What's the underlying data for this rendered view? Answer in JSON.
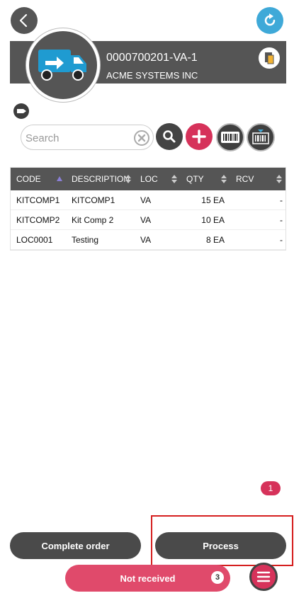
{
  "header": {
    "order_number": "0000700201-VA-1",
    "customer": "ACME SYSTEMS INC"
  },
  "search": {
    "placeholder": "Search",
    "value": ""
  },
  "grid": {
    "columns": [
      "CODE",
      "DESCRIPTION",
      "LOC",
      "QTY",
      "RCV"
    ],
    "rows": [
      {
        "code": "KITCOMP1",
        "description": "KITCOMP1",
        "loc": "VA",
        "qty": "15 EA",
        "rcv": "-"
      },
      {
        "code": "KITCOMP2",
        "description": "Kit Comp 2",
        "loc": "VA",
        "qty": "10 EA",
        "rcv": "-"
      },
      {
        "code": "LOC0001",
        "description": "Testing",
        "loc": "VA",
        "qty": "8 EA",
        "rcv": "-"
      }
    ]
  },
  "page_badge": "1",
  "actions": {
    "complete_label": "Complete order",
    "process_label": "Process",
    "not_received_label": "Not received",
    "not_received_count": "3"
  },
  "colors": {
    "accent_pink": "#d6325a",
    "refresh_blue": "#3fa9d8",
    "header_gray": "#555555",
    "truck_blue": "#1f9bd1",
    "highlight_red": "#d51f1f"
  },
  "icons": {
    "back": "chevron-left-icon",
    "refresh": "refresh-icon",
    "truck": "delivery-truck-icon",
    "document": "document-icon",
    "tag": "tag-icon",
    "clear": "clear-icon",
    "search": "search-icon",
    "add": "plus-icon",
    "barcode": "barcode-icon",
    "scan": "barcode-scan-icon",
    "menu": "hamburger-menu-icon"
  }
}
